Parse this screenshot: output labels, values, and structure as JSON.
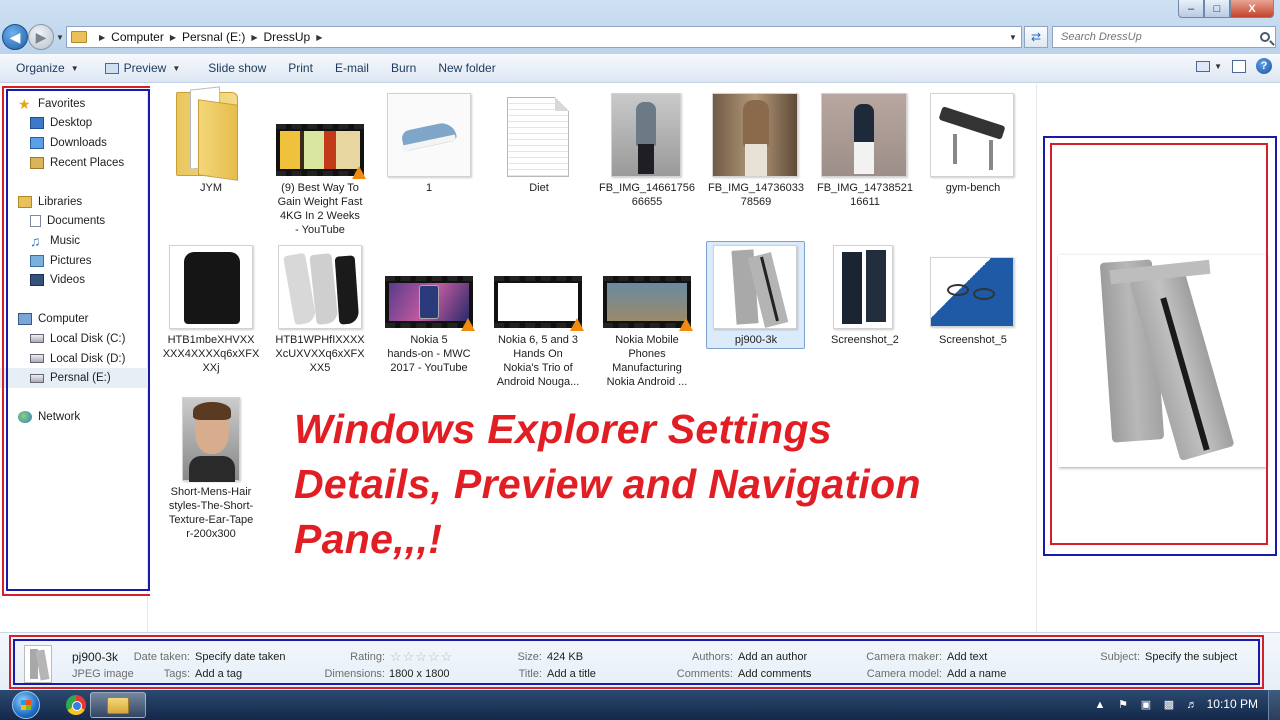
{
  "window": {
    "controls": {
      "minimize": "–",
      "maximize": "□",
      "close": "X"
    }
  },
  "address": {
    "crumbs": [
      "Computer",
      "Persnal (E:)",
      "DressUp"
    ]
  },
  "search": {
    "placeholder": "Search DressUp"
  },
  "toolbar": {
    "organize": "Organize",
    "preview": "Preview",
    "slideshow": "Slide show",
    "print": "Print",
    "email": "E-mail",
    "burn": "Burn",
    "new_folder": "New folder"
  },
  "nav": {
    "favorites": "Favorites",
    "desktop": "Desktop",
    "downloads": "Downloads",
    "recent": "Recent Places",
    "libraries": "Libraries",
    "documents": "Documents",
    "music": "Music",
    "pictures": "Pictures",
    "videos": "Videos",
    "computer": "Computer",
    "local_c": "Local Disk (C:)",
    "local_d": "Local Disk (D:)",
    "persnal_e": "Persnal (E:)",
    "network": "Network"
  },
  "files": [
    {
      "label": "JYM"
    },
    {
      "label": "(9) Best Way To Gain Weight Fast 4KG In 2 Weeks - YouTube"
    },
    {
      "label": "1"
    },
    {
      "label": "Diet"
    },
    {
      "label": "FB_IMG_1466175666655"
    },
    {
      "label": "FB_IMG_1473603378569"
    },
    {
      "label": "FB_IMG_1473852116611"
    },
    {
      "label": "gym-bench"
    },
    {
      "label": "HTB1mbeXHVXXXXX4XXXXq6xXFXXXj"
    },
    {
      "label": "HTB1WPHfIXXXXXcUXVXXq6xXFXXX5"
    },
    {
      "label": "Nokia 5 hands-on - MWC 2017 - YouTube"
    },
    {
      "label": "Nokia 6, 5 and 3 Hands On Nokia's Trio of Android Nouga..."
    },
    {
      "label": "Nokia Mobile Phones Manufacturing Nokia Android ..."
    },
    {
      "label": "pj900-3k"
    },
    {
      "label": "Screenshot_2"
    },
    {
      "label": "Screenshot_5"
    },
    {
      "label": "Short-Mens-Hairstyles-The-Short-Texture-Ear-Taper-200x300"
    }
  ],
  "captions": {
    "c1": [
      "(9) Best Way To",
      "Gain Weight Fast",
      "4KG In 2 Weeks",
      "- YouTube"
    ],
    "c4": [
      "FB_IMG_14661756",
      "66655"
    ],
    "c5": [
      "FB_IMG_14736033",
      "78569"
    ],
    "c6": [
      "FB_IMG_14738521",
      "16611"
    ],
    "c8": [
      "HTB1mbeXHVXX",
      "XXX4XXXXq6xXFX",
      "XXj"
    ],
    "c9": [
      "HTB1WPHfIXXXX",
      "XcUXVXXq6xXFX",
      "XX5"
    ],
    "c10": [
      "Nokia 5",
      "hands-on - MWC",
      "2017 - YouTube"
    ],
    "c11": [
      "Nokia 6, 5 and 3",
      "Hands On",
      "Nokia's Trio of",
      "Android Nouga..."
    ],
    "c12": [
      "Nokia Mobile",
      "Phones",
      "Manufacturing",
      "Nokia Android ..."
    ],
    "c16": [
      "Short-Mens-Hair",
      "styles-The-Short-",
      "Texture-Ear-Tape",
      "r-200x300"
    ]
  },
  "headline": [
    "Windows Explorer Settings",
    "Details, Preview and Navigation",
    "Pane,,,!"
  ],
  "details": {
    "name": "pj900-3k",
    "type": "JPEG image",
    "date_taken_label": "Date taken:",
    "date_taken": "Specify date taken",
    "tags_label": "Tags:",
    "tags": "Add a tag",
    "rating_label": "Rating:",
    "rating": "☆☆☆☆☆",
    "rating_value": 0,
    "dimensions_label": "Dimensions:",
    "dimensions": "1800 x 1800",
    "size_label": "Size:",
    "size": "424 KB",
    "title_label": "Title:",
    "title": "Add a title",
    "authors_label": "Authors:",
    "authors": "Add an author",
    "comments_label": "Comments:",
    "comments": "Add comments",
    "camera_maker_label": "Camera maker:",
    "camera_maker": "Add text",
    "camera_model_label": "Camera model:",
    "camera_model": "Add a name",
    "subject_label": "Subject:",
    "subject": "Specify the subject"
  },
  "taskbar": {
    "clock": "10:10 PM"
  },
  "colors": {
    "annotation_red": "#d4202a",
    "annotation_blue": "#1a1aa8",
    "headline": "#e01e24"
  }
}
